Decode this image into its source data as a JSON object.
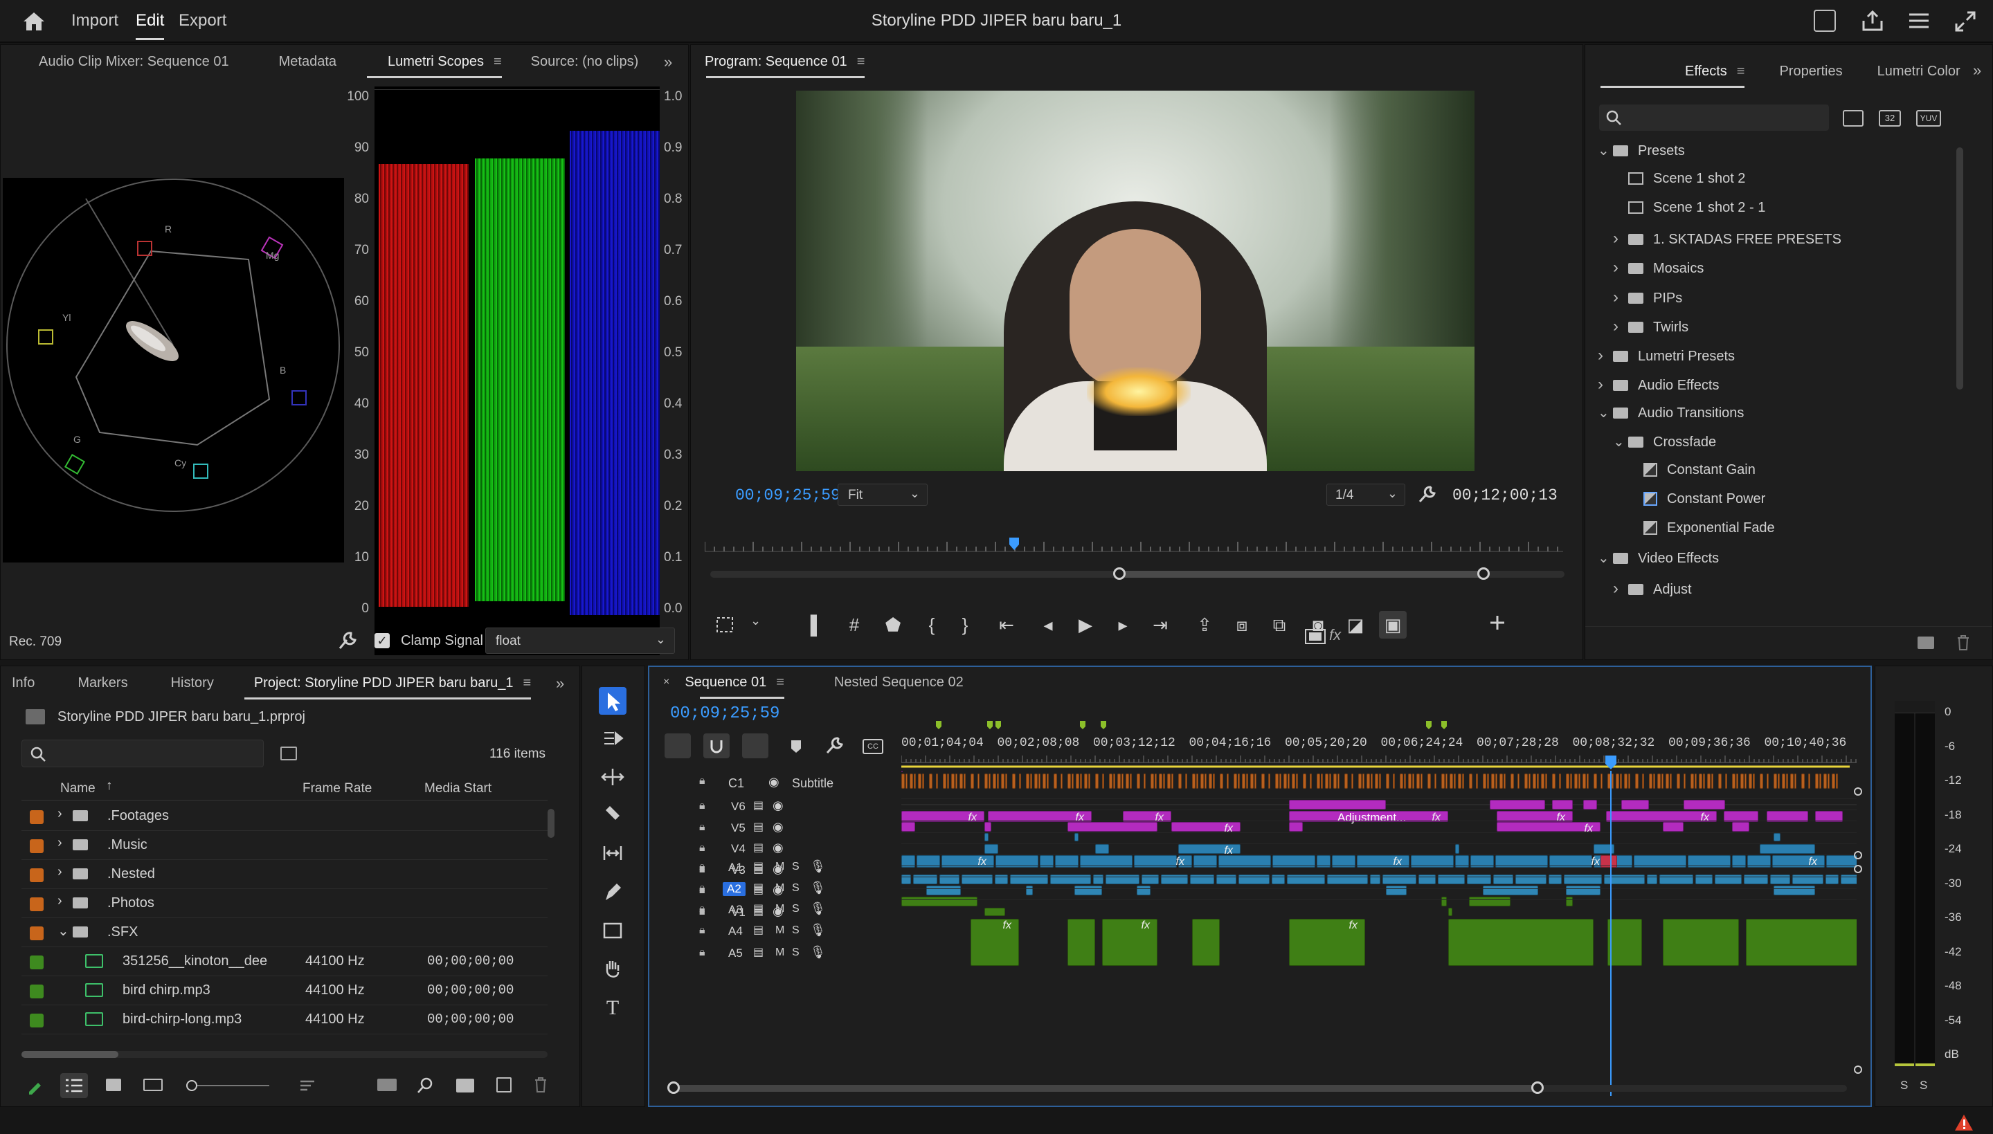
{
  "topbar": {
    "menu": [
      "Import",
      "Edit",
      "Export"
    ],
    "title": "Storyline PDD JIPER baru baru_1"
  },
  "scopes_panel": {
    "tabs": [
      "Audio Clip Mixer: Sequence 01",
      "Metadata",
      "Lumetri Scopes",
      "Source: (no clips)"
    ],
    "active_tab": "Lumetri Scopes",
    "left_axis": [
      "100",
      "90",
      "80",
      "70",
      "60",
      "50",
      "40",
      "30",
      "20",
      "10",
      "0"
    ],
    "right_axis": [
      "1.0",
      "0.9",
      "0.8",
      "0.7",
      "0.6",
      "0.5",
      "0.4",
      "0.3",
      "0.2",
      "0.1",
      "0.0"
    ],
    "vectorscope_labels": [
      "R",
      "Mg",
      "B",
      "Cy",
      "G",
      "Yl"
    ],
    "color_space": "Rec. 709",
    "clamp_signal": {
      "label": "Clamp Signal",
      "checked": true
    },
    "precision": "float"
  },
  "program_monitor": {
    "title": "Program: Sequence 01",
    "current_time": "00;09;25;59",
    "fit": "Fit",
    "resolution": "1/4",
    "duration": "00;12;00;13"
  },
  "effects_panel": {
    "tabs": [
      "Effects",
      "Properties",
      "Lumetri Color"
    ],
    "active_tab": "Effects",
    "format_buttons": [
      "32",
      "YUV"
    ],
    "tree": [
      {
        "label": "Presets",
        "level": 0,
        "icon": "folder",
        "expanded": true
      },
      {
        "label": "Scene 1 shot 2",
        "level": 1,
        "icon": "preset"
      },
      {
        "label": "Scene 1 shot 2 - 1",
        "level": 1,
        "icon": "preset"
      },
      {
        "label": "1. SKTADAS FREE PRESETS",
        "level": 1,
        "icon": "folder",
        "expanded": false
      },
      {
        "label": "Mosaics",
        "level": 1,
        "icon": "folder",
        "expanded": false
      },
      {
        "label": "PIPs",
        "level": 1,
        "icon": "folder",
        "expanded": false
      },
      {
        "label": "Twirls",
        "level": 1,
        "icon": "folder",
        "expanded": false
      },
      {
        "label": "Lumetri Presets",
        "level": 0,
        "icon": "folder",
        "expanded": false
      },
      {
        "label": "Audio Effects",
        "level": 0,
        "icon": "folder",
        "expanded": false
      },
      {
        "label": "Audio Transitions",
        "level": 0,
        "icon": "folder",
        "expanded": true
      },
      {
        "label": "Crossfade",
        "level": 1,
        "icon": "folder",
        "expanded": true
      },
      {
        "label": "Constant Gain",
        "level": 2,
        "icon": "transition"
      },
      {
        "label": "Constant Power",
        "level": 2,
        "icon": "transition"
      },
      {
        "label": "Exponential Fade",
        "level": 2,
        "icon": "transition"
      },
      {
        "label": "Video Effects",
        "level": 0,
        "icon": "folder",
        "expanded": true
      },
      {
        "label": "Adjust",
        "level": 1,
        "icon": "folder",
        "expanded": false
      }
    ]
  },
  "project_panel": {
    "tabs": [
      "Info",
      "Markers",
      "History",
      "Project: Storyline PDD JIPER baru baru_1"
    ],
    "active_tab": "Project: Storyline PDD JIPER baru baru_1",
    "file": "Storyline PDD JIPER baru baru_1.prproj",
    "count": "116 items",
    "columns": [
      "Name",
      "Frame Rate",
      "Media Start"
    ],
    "rows": [
      {
        "name": ".Footages",
        "type": "bin",
        "color": "#c8651b",
        "rate": "",
        "start": ""
      },
      {
        "name": ".Music",
        "type": "bin",
        "color": "#c8651b",
        "rate": "",
        "start": ""
      },
      {
        "name": ".Nested",
        "type": "bin",
        "color": "#c8651b",
        "rate": "",
        "start": ""
      },
      {
        "name": ".Photos",
        "type": "bin",
        "color": "#c8651b",
        "rate": "",
        "start": ""
      },
      {
        "name": ".SFX",
        "type": "bin",
        "color": "#c8651b",
        "rate": "",
        "start": "",
        "expanded": true
      },
      {
        "name": "351256__kinoton__dee",
        "type": "audio",
        "color": "#3e8a1f",
        "rate": "44100 Hz",
        "start": "00;00;00;00"
      },
      {
        "name": "bird chirp.mp3",
        "type": "audio",
        "color": "#3e8a1f",
        "rate": "44100 Hz",
        "start": "00;00;00;00"
      },
      {
        "name": "bird-chirp-long.mp3",
        "type": "audio",
        "color": "#3e8a1f",
        "rate": "44100 Hz",
        "start": "00;00;00;00"
      }
    ]
  },
  "timeline": {
    "tabs": [
      "Sequence 01",
      "Nested Sequence 02"
    ],
    "active_tab": "Sequence 01",
    "timecode": "00;09;25;59",
    "ruler": [
      "00;01;04;04",
      "00;02;08;08",
      "00;03;12;12",
      "00;04;16;16",
      "00;05;20;20",
      "00;06;24;24",
      "00;07;28;28",
      "00;08;32;32",
      "00;09;36;36",
      "00;10;40;36"
    ],
    "caption_track": {
      "name": "C1",
      "label": "Subtitle"
    },
    "video_tracks": [
      "V6",
      "V5",
      "V4",
      "V3",
      "V2",
      "V1"
    ],
    "audio_tracks": [
      "A1",
      "A2",
      "A3",
      "A4",
      "A5"
    ],
    "audio_mute": "M",
    "audio_solo": "S",
    "fx_label": "fx",
    "adjustment_label": "Adjustment..."
  },
  "audio_meter": {
    "scale": [
      "0",
      "-6",
      "-12",
      "-18",
      "-24",
      "-30",
      "-36",
      "-42",
      "-48",
      "-54",
      "dB"
    ],
    "solo": [
      "S",
      "S"
    ]
  },
  "colors": {
    "accent": "#3b9cff",
    "video_clip": "#b32bbf",
    "v1_clip": "#2a7fb0",
    "audio_clip": "#3f7f15",
    "caption_clip": "#b8601e"
  }
}
